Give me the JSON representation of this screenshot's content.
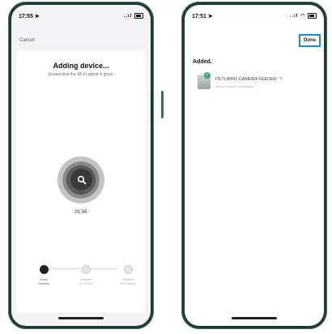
{
  "left_phone": {
    "status": {
      "time": "17:55",
      "signal": "..ıl"
    },
    "cancel_label": "Cancel",
    "title": "Adding device...",
    "subtitle": "Ensure that the Wi-Fi signal is good.",
    "timer": "01:56",
    "steps": [
      {
        "label": "Scan\ndevices",
        "active": true
      },
      {
        "label": "Register\non Cloud",
        "active": false
      },
      {
        "label": "Initialize\nthe device",
        "active": false
      }
    ]
  },
  "right_phone": {
    "status": {
      "time": "17:51",
      "signal": "..ıl"
    },
    "done_label": "Done",
    "added_label": "Added.",
    "device": {
      "name": "PETLIBRO CAMERA FEEDER",
      "status": "Device added successfully"
    }
  },
  "colors": {
    "phone_frame": "#1f3a32",
    "done_highlight": "#1e8ad6",
    "success_badge": "#3aa57a"
  },
  "icons": [
    "search-icon",
    "location-arrow-icon",
    "signal-icon",
    "wifi-icon",
    "battery-icon",
    "check-icon",
    "pencil-icon"
  ]
}
